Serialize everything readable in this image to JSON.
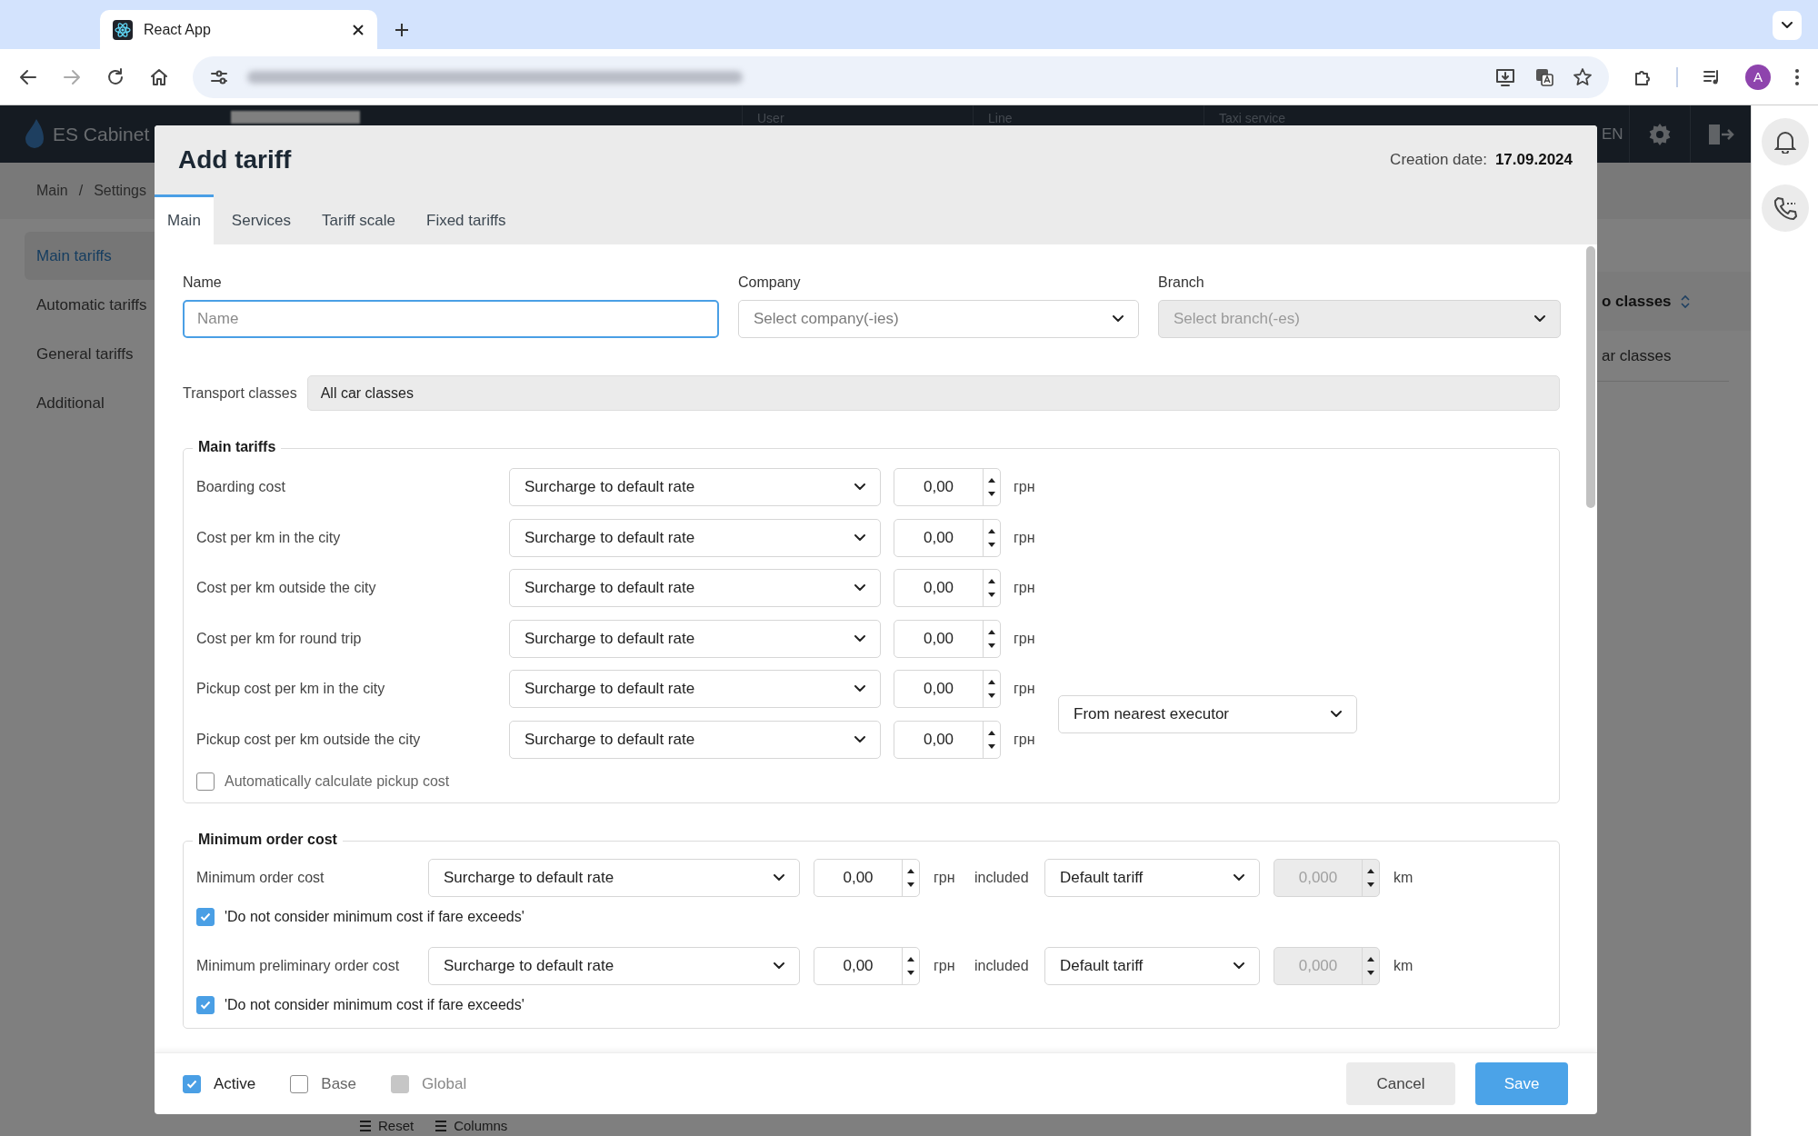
{
  "browser": {
    "tab_title": "React App",
    "avatar": "A"
  },
  "app": {
    "brand": "ES Cabinet",
    "header_columns": [
      "User",
      "Line",
      "Taxi service"
    ],
    "language": "EN",
    "breadcrumb": [
      "Main",
      "/",
      "Settings"
    ],
    "sidebar": [
      {
        "label": "Main tariffs",
        "selected": true
      },
      {
        "label": "Automatic tariffs",
        "selected": false
      },
      {
        "label": "General tariffs",
        "selected": false
      },
      {
        "label": "Additional",
        "selected": false
      }
    ],
    "table_header": "o classes",
    "table_cell": "ar classes",
    "toolbar": [
      "Reset",
      "Columns"
    ]
  },
  "modal": {
    "title": "Add tariff",
    "creation_date_label": "Creation date:",
    "creation_date": "17.09.2024",
    "tabs": [
      {
        "label": "Main",
        "selected": true
      },
      {
        "label": "Services",
        "selected": false
      },
      {
        "label": "Tariff scale",
        "selected": false
      },
      {
        "label": "Fixed tariffs",
        "selected": false
      }
    ],
    "name": {
      "label": "Name",
      "placeholder": "Name",
      "focused": true
    },
    "company": {
      "label": "Company",
      "placeholder": "Select company(-ies)",
      "disabled": false
    },
    "branch": {
      "label": "Branch",
      "placeholder": "Select branch(-es)",
      "disabled": true
    },
    "transport_classes": {
      "label": "Transport classes",
      "value": "All car classes"
    },
    "main_tariffs": {
      "title": "Main tariffs",
      "rows": [
        {
          "label": "Boarding cost",
          "mode": "Surcharge to default rate",
          "value": "0,00",
          "unit": "грн"
        },
        {
          "label": "Cost per km in the city",
          "mode": "Surcharge to default rate",
          "value": "0,00",
          "unit": "грн"
        },
        {
          "label": "Cost per km outside the city",
          "mode": "Surcharge to default rate",
          "value": "0,00",
          "unit": "грн"
        },
        {
          "label": "Cost per km for round trip",
          "mode": "Surcharge to default rate",
          "value": "0,00",
          "unit": "грн"
        },
        {
          "label": "Pickup cost per km in the city",
          "mode": "Surcharge to default rate",
          "value": "0,00",
          "unit": "грн"
        },
        {
          "label": "Pickup cost per km outside the city",
          "mode": "Surcharge to default rate",
          "value": "0,00",
          "unit": "грн"
        }
      ],
      "pickup_source": "From nearest executor",
      "auto_pickup": {
        "label": "Automatically calculate pickup cost",
        "checked": false
      }
    },
    "minimum_order": {
      "title": "Minimum order cost",
      "rows": [
        {
          "label": "Minimum order cost",
          "mode": "Surcharge to default rate",
          "value": "0,00",
          "unit": "грн",
          "included": "included",
          "base": "Default tariff",
          "distance": "0,000",
          "distance_unit": "km",
          "exceed": {
            "label": "'Do not consider minimum cost if fare exceeds'",
            "checked": true
          }
        },
        {
          "label": "Minimum preliminary order cost",
          "mode": "Surcharge to default rate",
          "value": "0,00",
          "unit": "грн",
          "included": "included",
          "base": "Default tariff",
          "distance": "0,000",
          "distance_unit": "km",
          "exceed": {
            "label": "'Do not consider minimum cost if fare exceeds'",
            "checked": true
          }
        }
      ]
    },
    "flags": [
      {
        "label": "Active",
        "checked": true,
        "disabled": false
      },
      {
        "label": "Base",
        "checked": false,
        "disabled": false
      },
      {
        "label": "Global",
        "checked": false,
        "disabled": true
      }
    ],
    "buttons": [
      {
        "label": "Cancel",
        "kind": "secondary"
      },
      {
        "label": "Save",
        "kind": "primary"
      }
    ]
  }
}
